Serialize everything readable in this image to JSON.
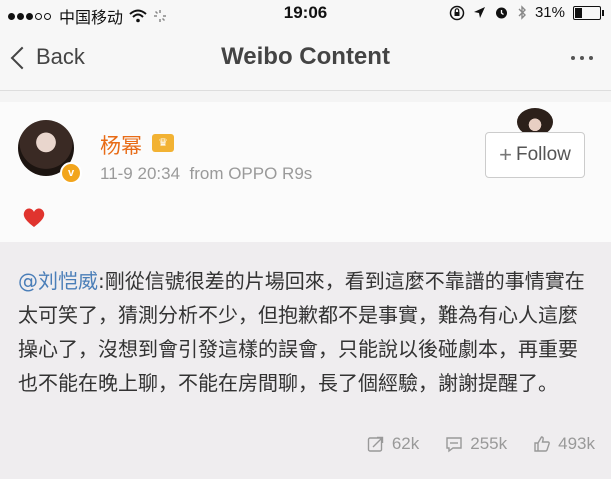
{
  "status_bar": {
    "carrier": "中国移动",
    "time": "19:06",
    "battery_percent": "31%",
    "battery_level": 0.31,
    "icons": [
      "signal-dots-icon",
      "wifi-icon",
      "loading-icon",
      "lock-rotation-icon",
      "location-icon",
      "alarm-icon",
      "bluetooth-icon",
      "battery-icon"
    ]
  },
  "nav": {
    "back_label": "Back",
    "title": "Weibo Content",
    "more_icon": "more-dots-icon"
  },
  "post": {
    "username": "杨幂",
    "timestamp": "11-9 20:34",
    "source": "from OPPO R9s",
    "follow_label": "Follow",
    "content_icon": "heart-icon",
    "heart_color": "#e0342e"
  },
  "repost": {
    "mention": "@刘恺威",
    "text": ":剛從信號很差的片場回來，看到這麼不靠譜的事情實在太可笑了，猜測分析不少，但抱歉都不是事實，難為有心人這麼操心了，沒想到會引發這樣的誤會，只能說以後碰劇本，再重要也不能在晚上聊，不能在房間聊，長了個經驗，謝謝提醒了。",
    "stats": {
      "reposts": "62k",
      "comments": "255k",
      "likes": "493k"
    }
  },
  "colors": {
    "username": "#e86b16",
    "mention": "#4a7eb8",
    "verified_badge": "#f2a51d"
  }
}
